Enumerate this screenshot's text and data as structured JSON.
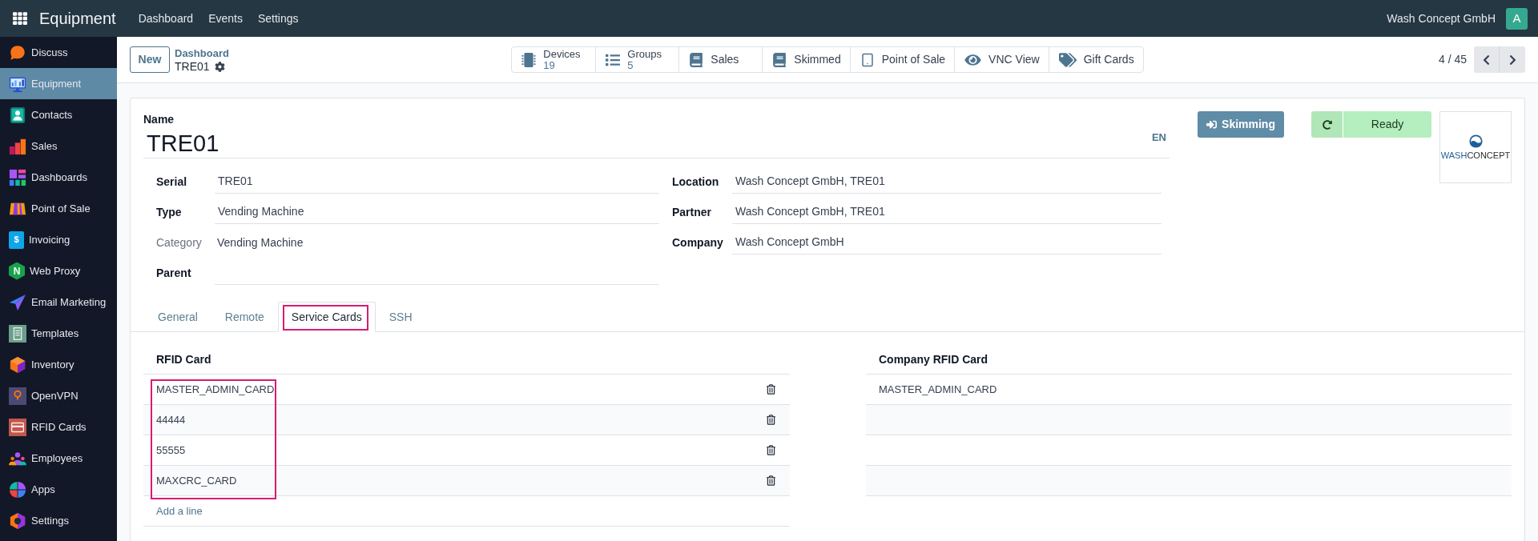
{
  "top_bar": {
    "app_name": "Equipment",
    "menu": [
      "Dashboard",
      "Events",
      "Settings"
    ],
    "company": "Wash Concept GmbH",
    "avatar": "A"
  },
  "sidebar": {
    "items": [
      {
        "label": "Discuss",
        "selected": false
      },
      {
        "label": "Equipment",
        "selected": true
      },
      {
        "label": "Contacts",
        "selected": false
      },
      {
        "label": "Sales",
        "selected": false
      },
      {
        "label": "Dashboards",
        "selected": false
      },
      {
        "label": "Point of Sale",
        "selected": false
      },
      {
        "label": "Invoicing",
        "selected": false,
        "icon_text": "$"
      },
      {
        "label": "Web Proxy",
        "selected": false,
        "icon_text": "N"
      },
      {
        "label": "Email Marketing",
        "selected": false
      },
      {
        "label": "Templates",
        "selected": false
      },
      {
        "label": "Inventory",
        "selected": false
      },
      {
        "label": "OpenVPN",
        "selected": false
      },
      {
        "label": "RFID Cards",
        "selected": false
      },
      {
        "label": "Employees",
        "selected": false
      },
      {
        "label": "Apps",
        "selected": false
      },
      {
        "label": "Settings",
        "selected": false
      }
    ]
  },
  "control_panel": {
    "new_button": "New",
    "breadcrumb": {
      "parent": "Dashboard",
      "current": "TRE01"
    },
    "smart_buttons": [
      {
        "label": "Devices",
        "count": "19"
      },
      {
        "label": "Groups",
        "count": "5"
      },
      {
        "label": "Sales"
      },
      {
        "label": "Skimmed"
      },
      {
        "label": "Point of Sale"
      },
      {
        "label": "VNC View"
      },
      {
        "label": "Gift Cards"
      }
    ],
    "pager": "4 / 45"
  },
  "form": {
    "name_label": "Name",
    "name": "TRE01",
    "language": "EN",
    "skimming_button": "Skimming",
    "status": {
      "kind": "ready",
      "label": "Ready"
    },
    "logo": {
      "wordmark": [
        "WASH",
        "CONCEPT"
      ]
    },
    "left_fields": [
      {
        "kind": "input",
        "label": "Serial",
        "value": "TRE01"
      },
      {
        "kind": "input",
        "label": "Type",
        "value": "Vending Machine"
      },
      {
        "kind": "readonly",
        "label": "Category",
        "value": "Vending Machine"
      },
      {
        "kind": "input",
        "label": "Parent"
      }
    ],
    "right_fields": [
      {
        "kind": "input",
        "label": "Location",
        "value": "Wash Concept GmbH, TRE01"
      },
      {
        "kind": "input",
        "label": "Partner",
        "value": "Wash Concept GmbH, TRE01"
      },
      {
        "kind": "input",
        "label": "Company",
        "value": "Wash Concept GmbH"
      }
    ],
    "tabs": [
      {
        "label": "General",
        "selected": false,
        "highlighted": false
      },
      {
        "label": "Remote",
        "selected": false,
        "highlighted": false
      },
      {
        "label": "Service Cards",
        "selected": true,
        "highlighted": true
      },
      {
        "label": "SSH",
        "selected": false,
        "highlighted": false
      }
    ],
    "rfid_table": {
      "column": "RFID Card",
      "highlighted": true,
      "rows": [
        "MASTER_ADMIN_CARD",
        "44444",
        "55555",
        "MAXCRC_CARD"
      ],
      "add_line": "Add a line"
    },
    "company_table": {
      "column": "Company RFID Card",
      "rows": [
        "MASTER_ADMIN_CARD"
      ]
    }
  }
}
